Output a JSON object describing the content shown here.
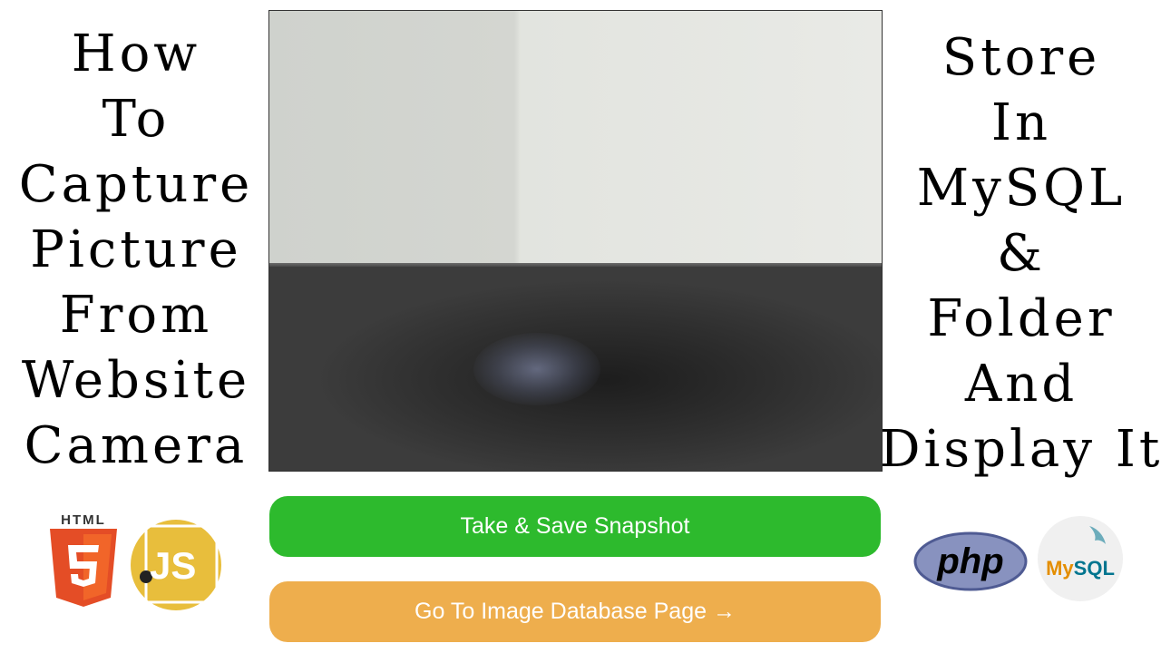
{
  "left_title": [
    "How",
    "To",
    "Capture",
    "Picture",
    "From",
    "Website",
    "Camera"
  ],
  "right_title": [
    "Store",
    "In",
    "MySQL",
    "&",
    "Folder",
    "And",
    "Display It"
  ],
  "buttons": {
    "snapshot_label": "Take & Save Snapshot",
    "database_label": "Go To Image Database Page →"
  },
  "logos": {
    "html5_label": "HTML",
    "html5_number": "5",
    "js_label": "JS",
    "php_label": "php",
    "mysql_my": "My",
    "mysql_sql": "SQL"
  },
  "colors": {
    "snapshot_button": "#2dba2d",
    "database_button": "#eeae4d",
    "html5_orange": "#e44d26",
    "js_yellow": "#e8be3c",
    "php_purple": "#8892bf"
  },
  "icons": [
    "html5-icon",
    "javascript-icon",
    "php-icon",
    "mysql-dolphin-icon"
  ]
}
